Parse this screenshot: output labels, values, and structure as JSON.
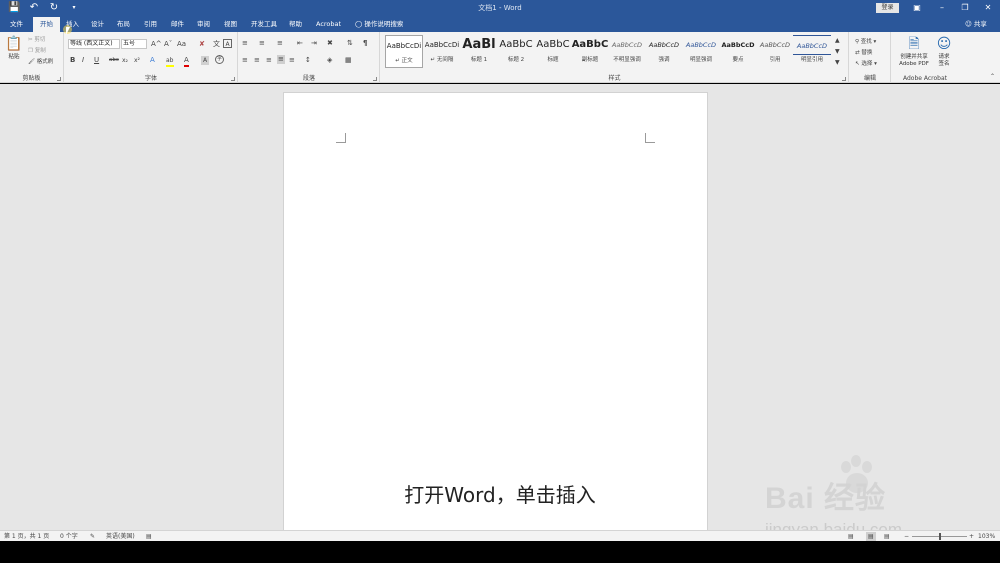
{
  "titlebar": {
    "title": "文档1 - Word",
    "login_label": "登录",
    "save_icon": "save-icon",
    "undo_icon": "undo-icon",
    "redo_icon": "redo-icon"
  },
  "tabs": [
    {
      "label": "文件",
      "active": false
    },
    {
      "label": "开始",
      "active": true
    },
    {
      "label": "插入",
      "active": false
    },
    {
      "label": "设计",
      "active": false
    },
    {
      "label": "布局",
      "active": false
    },
    {
      "label": "引用",
      "active": false
    },
    {
      "label": "邮件",
      "active": false
    },
    {
      "label": "审阅",
      "active": false
    },
    {
      "label": "视图",
      "active": false
    },
    {
      "label": "开发工具",
      "active": false
    },
    {
      "label": "帮助",
      "active": false
    },
    {
      "label": "Acrobat",
      "active": false
    }
  ],
  "tell_me": "操作说明搜索",
  "share_label": "共享",
  "clipboard": {
    "group": "剪贴板",
    "paste": "粘贴",
    "cut": "剪切",
    "copy": "复制",
    "format_painter": "格式刷"
  },
  "font": {
    "group": "字体",
    "font_name": "等线 (西文正文)",
    "font_size": "五号",
    "bold": "B",
    "italic": "I",
    "underline": "U",
    "strike": "abc",
    "sub": "x₂",
    "sup": "x²",
    "grow": "A^",
    "shrink": "Aˇ",
    "change_case": "Aa",
    "highlight": "ab",
    "font_color": "A"
  },
  "paragraph": {
    "group": "段落"
  },
  "styles": {
    "group": "样式",
    "items": [
      {
        "sample": "AaBbCcDi",
        "name": "↵ 正文"
      },
      {
        "sample": "AaBbCcDi",
        "name": "↵ 无间隔"
      },
      {
        "sample": "AaBl",
        "name": "标题 1"
      },
      {
        "sample": "AaBbC",
        "name": "标题 2"
      },
      {
        "sample": "AaBbC",
        "name": "标题"
      },
      {
        "sample": "AaBbC",
        "name": "副标题"
      },
      {
        "sample": "AaBbCcD",
        "name": "不明显强调"
      },
      {
        "sample": "AaBbCcD",
        "name": "强调"
      },
      {
        "sample": "AaBbCcD",
        "name": "明显强调"
      },
      {
        "sample": "AaBbCcD",
        "name": "要点"
      },
      {
        "sample": "AaBbCcD",
        "name": "引用"
      },
      {
        "sample": "AaBbCcD",
        "name": "明显引用"
      }
    ]
  },
  "editing": {
    "group": "编辑",
    "find": "查找",
    "replace": "替换",
    "select": "选择"
  },
  "acrobat": {
    "group": "Adobe Acrobat",
    "create_line1": "创建并共享",
    "create_line2": "Adobe PDF",
    "sign_line1": "请求",
    "sign_line2": "签名"
  },
  "subtitle": "打开Word，单击插入",
  "watermark": {
    "brand": "Bai  经验",
    "url": "jingyan.baidu.com"
  },
  "status": {
    "page": "第 1 页，共 1 页",
    "words": "0 个字",
    "language": "英语(美国)",
    "zoom": "103%",
    "zoom_minus": "−",
    "zoom_plus": "+"
  }
}
